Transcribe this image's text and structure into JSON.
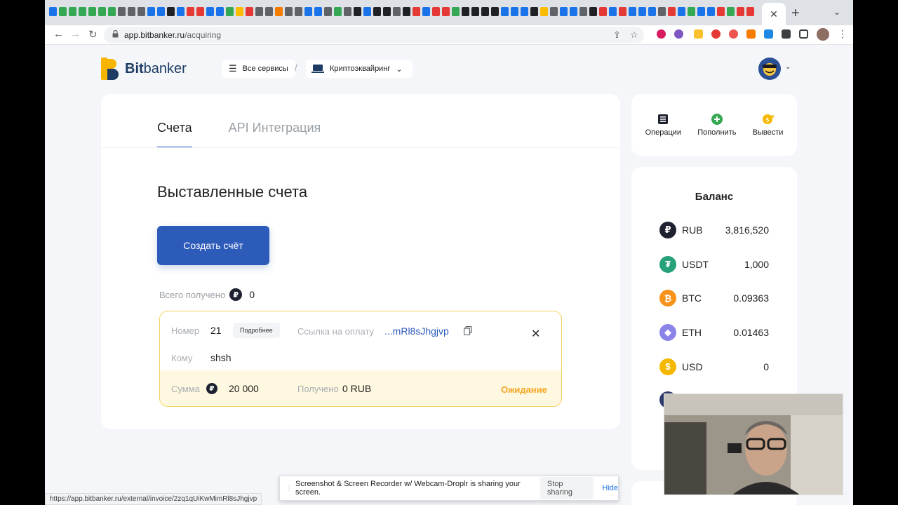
{
  "browser": {
    "url_host": "app.bitbanker.ru",
    "url_path": "/acquiring",
    "status_url": "https://app.bitbanker.ru/external/invoice/2zq1qUiKwMimRl8sJhgjvp"
  },
  "header": {
    "logo_bold": "Bit",
    "logo_rest": "banker",
    "all_services": "Все сервисы",
    "breadcrumb_sep": "/",
    "product": "Криптоэквайринг"
  },
  "main": {
    "tabs": [
      {
        "label": "Счета",
        "active": true
      },
      {
        "label": "API Интеграция",
        "active": false
      }
    ],
    "title": "Выставленные счета",
    "create_button": "Создать счёт",
    "total_label": "Всего получено",
    "total_value": "0"
  },
  "invoice": {
    "number_label": "Номер",
    "number": "21",
    "details_button": "Подробнее",
    "link_label": "Ссылка на оплату",
    "link_value": "...mRl8sJhgjvp",
    "to_label": "Кому",
    "to_value": "shsh",
    "amount_label": "Сумма",
    "amount": "20 000",
    "received_label": "Получено",
    "received": "0 RUB",
    "status": "Ожидание"
  },
  "actions": [
    {
      "label": "Операции",
      "icon": "list-icon"
    },
    {
      "label": "Пополнить",
      "icon": "plus-circle-icon"
    },
    {
      "label": "Вывести",
      "icon": "coin-out-icon"
    }
  ],
  "balance": {
    "title": "Баланс",
    "rows": [
      {
        "currency": "RUB",
        "amount": "3,816,520",
        "symbol": "₽",
        "color": "#1e2230"
      },
      {
        "currency": "USDT",
        "amount": "1,000",
        "symbol": "₮",
        "color": "#26a17b"
      },
      {
        "currency": "BTC",
        "amount": "0.09363",
        "symbol": "₿",
        "color": "#f7931a"
      },
      {
        "currency": "ETH",
        "amount": "0.01463",
        "symbol": "◆",
        "color": "#8a84e8"
      },
      {
        "currency": "USD",
        "amount": "0",
        "symbol": "$",
        "color": "#f5b800"
      }
    ]
  },
  "share_banner": {
    "message": "Screenshot & Screen Recorder w/ Webcam-Droplr is sharing your screen.",
    "stop": "Stop sharing",
    "hide": "Hide"
  },
  "colors": {
    "primary": "#2d5bb9",
    "pending": "#f5a623",
    "invoice_border": "#f5d15e"
  }
}
